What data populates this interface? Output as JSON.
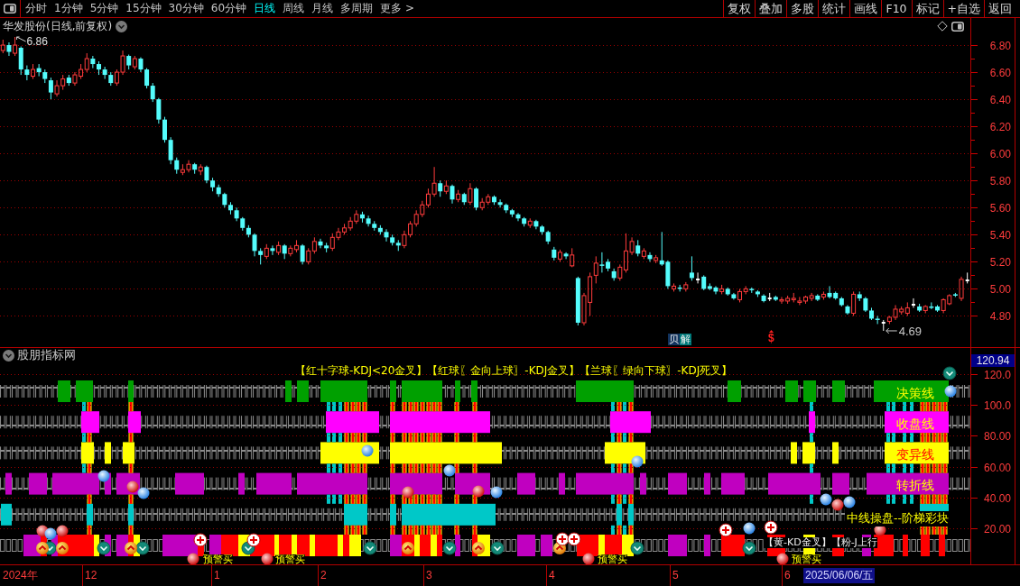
{
  "toolbar": {
    "tabs": [
      {
        "label": "分时",
        "selected": false
      },
      {
        "label": "1分钟",
        "selected": false
      },
      {
        "label": "5分钟",
        "selected": false
      },
      {
        "label": "15分钟",
        "selected": false
      },
      {
        "label": "30分钟",
        "selected": false
      },
      {
        "label": "60分钟",
        "selected": false
      },
      {
        "label": "日线",
        "selected": true
      },
      {
        "label": "周线",
        "selected": false
      },
      {
        "label": "月线",
        "selected": false
      },
      {
        "label": "多周期",
        "selected": false
      },
      {
        "label": "更多 >",
        "selected": false
      }
    ],
    "buttons": [
      "复权",
      "叠加",
      "多股",
      "统计",
      "画线",
      "F10",
      "标记",
      "+自选",
      "返回"
    ]
  },
  "price_pane": {
    "title": "华发股份(日线,前复权)",
    "chart_data": {
      "type": "candlestick",
      "ylim": [
        4.57,
        6.88
      ],
      "yticks": [
        {
          "value": 4.8,
          "label": "4.80"
        },
        {
          "value": 5.0,
          "label": "5.00"
        },
        {
          "value": 5.2,
          "label": "5.20"
        },
        {
          "value": 5.4,
          "label": "5.40"
        },
        {
          "value": 5.6,
          "label": "5.60"
        },
        {
          "value": 5.8,
          "label": "5.80"
        },
        {
          "value": 6.0,
          "label": "6.00"
        },
        {
          "value": 6.2,
          "label": "6.20"
        },
        {
          "value": 6.4,
          "label": "6.40"
        },
        {
          "value": 6.6,
          "label": "6.60"
        },
        {
          "value": 6.8,
          "label": "6.80"
        }
      ],
      "grid": true,
      "ohlc": [
        [
          6.76,
          6.84,
          6.74,
          6.8
        ],
        [
          6.8,
          6.82,
          6.72,
          6.75
        ],
        [
          6.74,
          6.86,
          6.72,
          6.8
        ],
        [
          6.78,
          6.79,
          6.58,
          6.62
        ],
        [
          6.62,
          6.65,
          6.54,
          6.58
        ],
        [
          6.57,
          6.66,
          6.55,
          6.62
        ],
        [
          6.63,
          6.66,
          6.57,
          6.6
        ],
        [
          6.6,
          6.62,
          6.52,
          6.55
        ],
        [
          6.54,
          6.56,
          6.4,
          6.45
        ],
        [
          6.44,
          6.54,
          6.42,
          6.5
        ],
        [
          6.5,
          6.58,
          6.47,
          6.55
        ],
        [
          6.56,
          6.58,
          6.5,
          6.52
        ],
        [
          6.52,
          6.6,
          6.5,
          6.58
        ],
        [
          6.57,
          6.66,
          6.55,
          6.62
        ],
        [
          6.62,
          6.74,
          6.6,
          6.7
        ],
        [
          6.7,
          6.72,
          6.63,
          6.66
        ],
        [
          6.66,
          6.68,
          6.58,
          6.62
        ],
        [
          6.62,
          6.64,
          6.55,
          6.58
        ],
        [
          6.58,
          6.6,
          6.5,
          6.52
        ],
        [
          6.52,
          6.62,
          6.5,
          6.6
        ],
        [
          6.6,
          6.76,
          6.58,
          6.72
        ],
        [
          6.72,
          6.73,
          6.62,
          6.65
        ],
        [
          6.64,
          6.72,
          6.62,
          6.7
        ],
        [
          6.7,
          6.71,
          6.6,
          6.62
        ],
        [
          6.62,
          6.63,
          6.48,
          6.5
        ],
        [
          6.5,
          6.52,
          6.38,
          6.4
        ],
        [
          6.4,
          6.41,
          6.22,
          6.25
        ],
        [
          6.25,
          6.27,
          6.08,
          6.1
        ],
        [
          6.1,
          6.12,
          5.92,
          5.95
        ],
        [
          5.95,
          5.97,
          5.85,
          5.88
        ],
        [
          5.86,
          5.92,
          5.84,
          5.88
        ],
        [
          5.88,
          5.95,
          5.86,
          5.92
        ],
        [
          5.92,
          5.93,
          5.85,
          5.88
        ],
        [
          5.87,
          5.92,
          5.84,
          5.9
        ],
        [
          5.9,
          5.91,
          5.78,
          5.8
        ],
        [
          5.8,
          5.82,
          5.72,
          5.75
        ],
        [
          5.75,
          5.77,
          5.68,
          5.7
        ],
        [
          5.7,
          5.71,
          5.6,
          5.62
        ],
        [
          5.62,
          5.64,
          5.55,
          5.58
        ],
        [
          5.58,
          5.6,
          5.5,
          5.52
        ],
        [
          5.52,
          5.53,
          5.43,
          5.45
        ],
        [
          5.45,
          5.47,
          5.38,
          5.4
        ],
        [
          5.4,
          5.41,
          5.24,
          5.28
        ],
        [
          5.28,
          5.3,
          5.18,
          5.25
        ],
        [
          5.24,
          5.33,
          5.22,
          5.3
        ],
        [
          5.3,
          5.32,
          5.25,
          5.28
        ],
        [
          5.27,
          5.35,
          5.25,
          5.32
        ],
        [
          5.32,
          5.33,
          5.22,
          5.26
        ],
        [
          5.26,
          5.32,
          5.24,
          5.3
        ],
        [
          5.29,
          5.36,
          5.27,
          5.32
        ],
        [
          5.32,
          5.33,
          5.18,
          5.2
        ],
        [
          5.2,
          5.3,
          5.18,
          5.28
        ],
        [
          5.28,
          5.38,
          5.26,
          5.35
        ],
        [
          5.35,
          5.37,
          5.3,
          5.32
        ],
        [
          5.32,
          5.34,
          5.27,
          5.3
        ],
        [
          5.3,
          5.41,
          5.28,
          5.38
        ],
        [
          5.38,
          5.45,
          5.36,
          5.42
        ],
        [
          5.42,
          5.48,
          5.4,
          5.45
        ],
        [
          5.45,
          5.53,
          5.43,
          5.5
        ],
        [
          5.5,
          5.58,
          5.48,
          5.55
        ],
        [
          5.55,
          5.57,
          5.49,
          5.52
        ],
        [
          5.52,
          5.54,
          5.46,
          5.48
        ],
        [
          5.48,
          5.5,
          5.43,
          5.45
        ],
        [
          5.45,
          5.47,
          5.4,
          5.42
        ],
        [
          5.42,
          5.44,
          5.35,
          5.38
        ],
        [
          5.38,
          5.4,
          5.32,
          5.34
        ],
        [
          5.34,
          5.36,
          5.28,
          5.32
        ],
        [
          5.32,
          5.43,
          5.3,
          5.4
        ],
        [
          5.4,
          5.5,
          5.38,
          5.48
        ],
        [
          5.48,
          5.58,
          5.46,
          5.55
        ],
        [
          5.55,
          5.65,
          5.53,
          5.62
        ],
        [
          5.62,
          5.74,
          5.6,
          5.7
        ],
        [
          5.7,
          5.9,
          5.68,
          5.78
        ],
        [
          5.78,
          5.8,
          5.68,
          5.72
        ],
        [
          5.72,
          5.8,
          5.7,
          5.76
        ],
        [
          5.76,
          5.77,
          5.63,
          5.66
        ],
        [
          5.66,
          5.73,
          5.64,
          5.7
        ],
        [
          5.7,
          5.71,
          5.62,
          5.64
        ],
        [
          5.64,
          5.78,
          5.62,
          5.74
        ],
        [
          5.74,
          5.75,
          5.58,
          5.6
        ],
        [
          5.6,
          5.67,
          5.58,
          5.64
        ],
        [
          5.64,
          5.7,
          5.62,
          5.68
        ],
        [
          5.68,
          5.69,
          5.62,
          5.64
        ],
        [
          5.64,
          5.66,
          5.6,
          5.62
        ],
        [
          5.62,
          5.63,
          5.56,
          5.58
        ],
        [
          5.58,
          5.59,
          5.53,
          5.55
        ],
        [
          5.55,
          5.56,
          5.5,
          5.52
        ],
        [
          5.52,
          5.53,
          5.46,
          5.48
        ],
        [
          5.47,
          5.52,
          5.45,
          5.5
        ],
        [
          5.5,
          5.51,
          5.44,
          5.46
        ],
        [
          5.46,
          5.47,
          5.4,
          5.42
        ],
        [
          5.42,
          5.43,
          5.33,
          5.35
        ],
        [
          5.29,
          5.31,
          5.21,
          5.23
        ],
        [
          5.22,
          5.29,
          5.2,
          5.27
        ],
        [
          5.26,
          5.27,
          5.22,
          5.24
        ],
        [
          5.17,
          5.3,
          5.16,
          5.25
        ],
        [
          5.08,
          5.09,
          4.73,
          4.75
        ],
        [
          4.75,
          4.97,
          4.73,
          4.95
        ],
        [
          4.9,
          5.12,
          4.8,
          5.09
        ],
        [
          5.1,
          5.24,
          5.04,
          5.19
        ],
        [
          5.18,
          5.27,
          5.12,
          5.17
        ],
        [
          5.2,
          5.22,
          5.13,
          5.15
        ],
        [
          5.13,
          5.15,
          5.06,
          5.08
        ],
        [
          5.08,
          5.18,
          5.06,
          5.16
        ],
        [
          5.14,
          5.41,
          5.12,
          5.28
        ],
        [
          5.27,
          5.38,
          5.25,
          5.35
        ],
        [
          5.32,
          5.36,
          5.24,
          5.26
        ],
        [
          5.24,
          5.3,
          5.22,
          5.28
        ],
        [
          5.25,
          5.27,
          5.2,
          5.22
        ],
        [
          5.21,
          5.25,
          5.19,
          5.23
        ],
        [
          5.21,
          5.42,
          5.17,
          5.18
        ],
        [
          5.2,
          5.21,
          5,
          5.02
        ],
        [
          5,
          5.04,
          4.98,
          5.02
        ],
        [
          5.01,
          5.03,
          4.98,
          5
        ],
        [
          5,
          5.05,
          4.98,
          5.03
        ],
        [
          5.12,
          5.24,
          5.06,
          5.08
        ],
        [
          5.07,
          5.12,
          5.04,
          5.07
        ],
        [
          5.09,
          5.1,
          4.99,
          5
        ],
        [
          5.02,
          5.04,
          4.99,
          5
        ],
        [
          5.01,
          5.02,
          4.96,
          4.98
        ],
        [
          4.98,
          5.03,
          4.96,
          5
        ],
        [
          5,
          5.01,
          4.95,
          4.96
        ],
        [
          4.96,
          4.97,
          4.92,
          4.93
        ],
        [
          4.92,
          5,
          4.9,
          4.98
        ],
        [
          4.98,
          5.02,
          4.96,
          5
        ],
        [
          5,
          5.01,
          4.97,
          4.99
        ],
        [
          4.98,
          4.99,
          4.94,
          4.96
        ],
        [
          4.95,
          4.96,
          4.9,
          4.91
        ],
        [
          4.93,
          4.97,
          4.91,
          4.93
        ],
        [
          4.94,
          4.95,
          4.91,
          4.92
        ],
        [
          4.91,
          4.94,
          4.89,
          4.92
        ],
        [
          4.91,
          4.95,
          4.89,
          4.93
        ],
        [
          4.92,
          4.97,
          4.9,
          4.93
        ],
        [
          4.9,
          4.94,
          4.88,
          4.91
        ],
        [
          4.91,
          4.95,
          4.89,
          4.94
        ],
        [
          4.93,
          4.97,
          4.91,
          4.95
        ],
        [
          4.95,
          4.96,
          4.91,
          4.92
        ],
        [
          4.94,
          4.98,
          4.92,
          4.96
        ],
        [
          4.97,
          5.02,
          4.93,
          4.94
        ],
        [
          4.97,
          4.98,
          4.92,
          4.93
        ],
        [
          4.93,
          4.94,
          4.87,
          4.88
        ],
        [
          4.87,
          4.88,
          4.81,
          4.82
        ],
        [
          4.82,
          4.98,
          4.8,
          4.96
        ],
        [
          4.96,
          4.98,
          4.91,
          4.93
        ],
        [
          4.93,
          4.94,
          4.83,
          4.84
        ],
        [
          4.84,
          4.86,
          4.77,
          4.78
        ],
        [
          4.78,
          4.8,
          4.74,
          4.77
        ],
        [
          4.75,
          4.77,
          4.69,
          4.75
        ],
        [
          4.76,
          4.8,
          4.74,
          4.79
        ],
        [
          4.79,
          4.88,
          4.77,
          4.85
        ],
        [
          4.83,
          4.87,
          4.81,
          4.85
        ],
        [
          4.82,
          4.9,
          4.8,
          4.86
        ],
        [
          4.88,
          4.93,
          4.86,
          4.88
        ],
        [
          4.87,
          4.89,
          4.83,
          4.84
        ],
        [
          4.84,
          4.88,
          4.82,
          4.87
        ],
        [
          4.87,
          4.9,
          4.85,
          4.86
        ],
        [
          4.87,
          4.88,
          4.83,
          4.84
        ],
        [
          4.84,
          4.93,
          4.82,
          4.92
        ],
        [
          4.89,
          4.96,
          4.88,
          4.95
        ],
        [
          4.96,
          4.97,
          4.94,
          4.95
        ],
        [
          4.93,
          5.09,
          4.91,
          5.07
        ],
        [
          5.06,
          5.12,
          5.04,
          5.06
        ]
      ],
      "annotations": [
        "6.86",
        "4.69"
      ]
    },
    "signals": [
      {
        "text": "贝",
        "kind": "badge",
        "color": "#12335e"
      },
      {
        "text": "解",
        "kind": "badge",
        "color": "#007a7a"
      },
      {
        "text": "$",
        "kind": "symbol",
        "color": "#ff2020"
      }
    ]
  },
  "indicator_pane": {
    "title": "股朋指标网",
    "current_value": "120.94",
    "legend": "【红十字球-KDJ<20金叉】【红球〖金向上球〗-KDJ金叉】【兰球〖绿向下球〗-KDJ死叉】",
    "row_labels": [
      "决策线",
      "收盘线",
      "变异线",
      "转折线",
      "中线操盘--阶梯彩块"
    ],
    "note": "【黄-KD金叉】【粉-J上行",
    "alerts": [
      "预警买",
      "预警买",
      "预警买",
      "预警买"
    ],
    "axis_labels": [
      "120.0",
      "100.0",
      "80.00",
      "60.00",
      "40.00",
      "20.00"
    ]
  },
  "date_axis": {
    "labels": [
      "2024年",
      "12",
      "1",
      "2",
      "3",
      "4",
      "5",
      "6"
    ],
    "cursor_date": "2025/06/06/五"
  }
}
